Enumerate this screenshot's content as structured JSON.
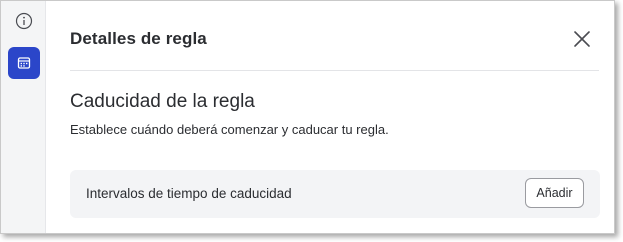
{
  "sidebar": {
    "items": [
      {
        "icon": "info-icon",
        "active": false
      },
      {
        "icon": "calendar-icon",
        "active": true
      }
    ],
    "active_color": "#2b46c9"
  },
  "panel": {
    "title": "Detalles de regla",
    "close_icon": "close-icon"
  },
  "expiration": {
    "title": "Caducidad de la regla",
    "description": "Establece cuándo deberá comenzar y caducar tu regla.",
    "intervals_label": "Intervalos de tiempo de caducidad",
    "add_label": "Añadir"
  }
}
